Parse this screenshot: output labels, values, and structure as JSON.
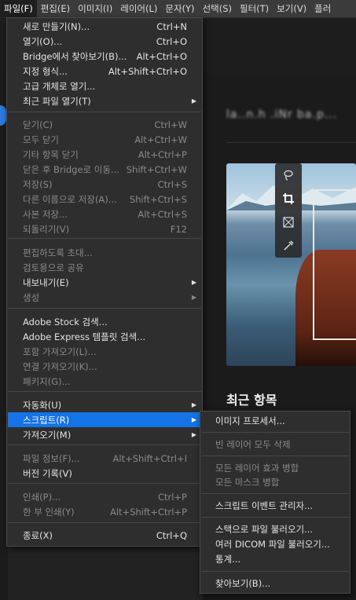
{
  "menubar": [
    {
      "label": "파일(F)",
      "active": true
    },
    {
      "label": "편집(E)"
    },
    {
      "label": "이미지(I)"
    },
    {
      "label": "레이어(L)"
    },
    {
      "label": "문자(Y)"
    },
    {
      "label": "선택(S)"
    },
    {
      "label": "필터(T)"
    },
    {
      "label": "보기(V)"
    },
    {
      "label": "플러"
    }
  ],
  "file_menu": [
    {
      "label": "새로 만들기(N)...",
      "shortcut": "Ctrl+N"
    },
    {
      "label": "열기(O)...",
      "shortcut": "Ctrl+O"
    },
    {
      "label": "Bridge에서 찾아보기(B)...",
      "shortcut": "Alt+Ctrl+O"
    },
    {
      "label": "지정 형식...",
      "shortcut": "Alt+Shift+Ctrl+O"
    },
    {
      "label": "고급 개체로 열기...",
      "shortcut": ""
    },
    {
      "label": "최근 파일 열기(T)",
      "shortcut": "",
      "submenu": true
    },
    {
      "label": "닫기(C)",
      "shortcut": "Ctrl+W",
      "disabled": true
    },
    {
      "label": "모두 닫기",
      "shortcut": "Alt+Ctrl+W",
      "disabled": true
    },
    {
      "label": "기타 항목 닫기",
      "shortcut": "Alt+Ctrl+P",
      "disabled": true
    },
    {
      "label": "닫은 후 Bridge로 이동...",
      "shortcut": "Shift+Ctrl+W",
      "disabled": true
    },
    {
      "label": "저장(S)",
      "shortcut": "Ctrl+S",
      "disabled": true
    },
    {
      "label": "다른 이름으로 저장(A)...",
      "shortcut": "Shift+Ctrl+S",
      "disabled": true
    },
    {
      "label": "사본 저장...",
      "shortcut": "Alt+Ctrl+S",
      "disabled": true
    },
    {
      "label": "되돌리기(V)",
      "shortcut": "F12",
      "disabled": true
    },
    {
      "label": "편집하도록 초대...",
      "shortcut": "",
      "disabled": true
    },
    {
      "label": "검토용으로 공유",
      "shortcut": "",
      "disabled": true
    },
    {
      "label": "내보내기(E)",
      "shortcut": "",
      "submenu": true
    },
    {
      "label": "생성",
      "shortcut": "",
      "submenu": true,
      "disabled": true
    },
    {
      "label": "Adobe Stock 검색...",
      "shortcut": ""
    },
    {
      "label": "Adobe Express 템플릿 검색...",
      "shortcut": ""
    },
    {
      "label": "포함 가져오기(L)...",
      "shortcut": "",
      "disabled": true
    },
    {
      "label": "연결 가져오기(K)...",
      "shortcut": "",
      "disabled": true
    },
    {
      "label": "패키지(G)...",
      "shortcut": "",
      "disabled": true
    },
    {
      "label": "자동화(U)",
      "shortcut": "",
      "submenu": true
    },
    {
      "label": "스크립트(R)",
      "shortcut": "",
      "submenu": true,
      "highlighted": true
    },
    {
      "label": "가져오기(M)",
      "shortcut": "",
      "submenu": true
    },
    {
      "label": "파일 정보(F)...",
      "shortcut": "Alt+Shift+Ctrl+I",
      "disabled": true
    },
    {
      "label": "버전 기록(V)",
      "shortcut": ""
    },
    {
      "label": "인쇄(P)...",
      "shortcut": "Ctrl+P",
      "disabled": true
    },
    {
      "label": "한 부 인쇄(Y)",
      "shortcut": "Alt+Shift+Ctrl+P",
      "disabled": true
    },
    {
      "label": "종료(X)",
      "shortcut": "Ctrl+Q"
    }
  ],
  "script_submenu": [
    {
      "label": "이미지 프로세서..."
    },
    {
      "label": "빈 레이어 모두 삭제",
      "disabled": true
    },
    {
      "label": "모든 레이어 효과 병합",
      "disabled": true
    },
    {
      "label": "모든 마스크 병합",
      "disabled": true
    },
    {
      "label": "스크립트 이벤트 관리자..."
    },
    {
      "label": "스택으로 파일 불러오기..."
    },
    {
      "label": "여러 DICOM 파일 불러오기..."
    },
    {
      "label": "통계..."
    },
    {
      "label": "찾아보기(B)..."
    }
  ],
  "home": {
    "recent_label": "최근 항목",
    "blurred_title": "la..n.h .iNr ba.p..."
  }
}
